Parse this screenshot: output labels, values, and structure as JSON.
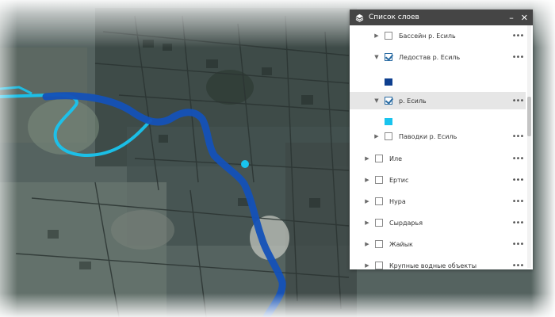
{
  "panel": {
    "title": "Список слоев",
    "minimize": "–",
    "close": "✕"
  },
  "layers": [
    {
      "label": "Бассейн р. Есиль",
      "checked": false
    },
    {
      "label": "Ледостав р. Есиль",
      "checked": true,
      "swatch": "#0e3f8f"
    },
    {
      "label": "р. Есиль",
      "checked": true,
      "swatch": "#19c4ee",
      "selected": true
    },
    {
      "label": "Паводки р. Есиль",
      "checked": false
    },
    {
      "label": "Иле",
      "checked": false
    },
    {
      "label": "Ертис",
      "checked": false
    },
    {
      "label": "Нура",
      "checked": false
    },
    {
      "label": "Сырдарья",
      "checked": false
    },
    {
      "label": "Жайык",
      "checked": false
    },
    {
      "label": "Крупные водные объекты",
      "checked": false
    }
  ],
  "more_label": "•••",
  "colors": {
    "river_dark": "#1451b8",
    "river_light": "#19c4ee",
    "header_bg": "#454545"
  }
}
